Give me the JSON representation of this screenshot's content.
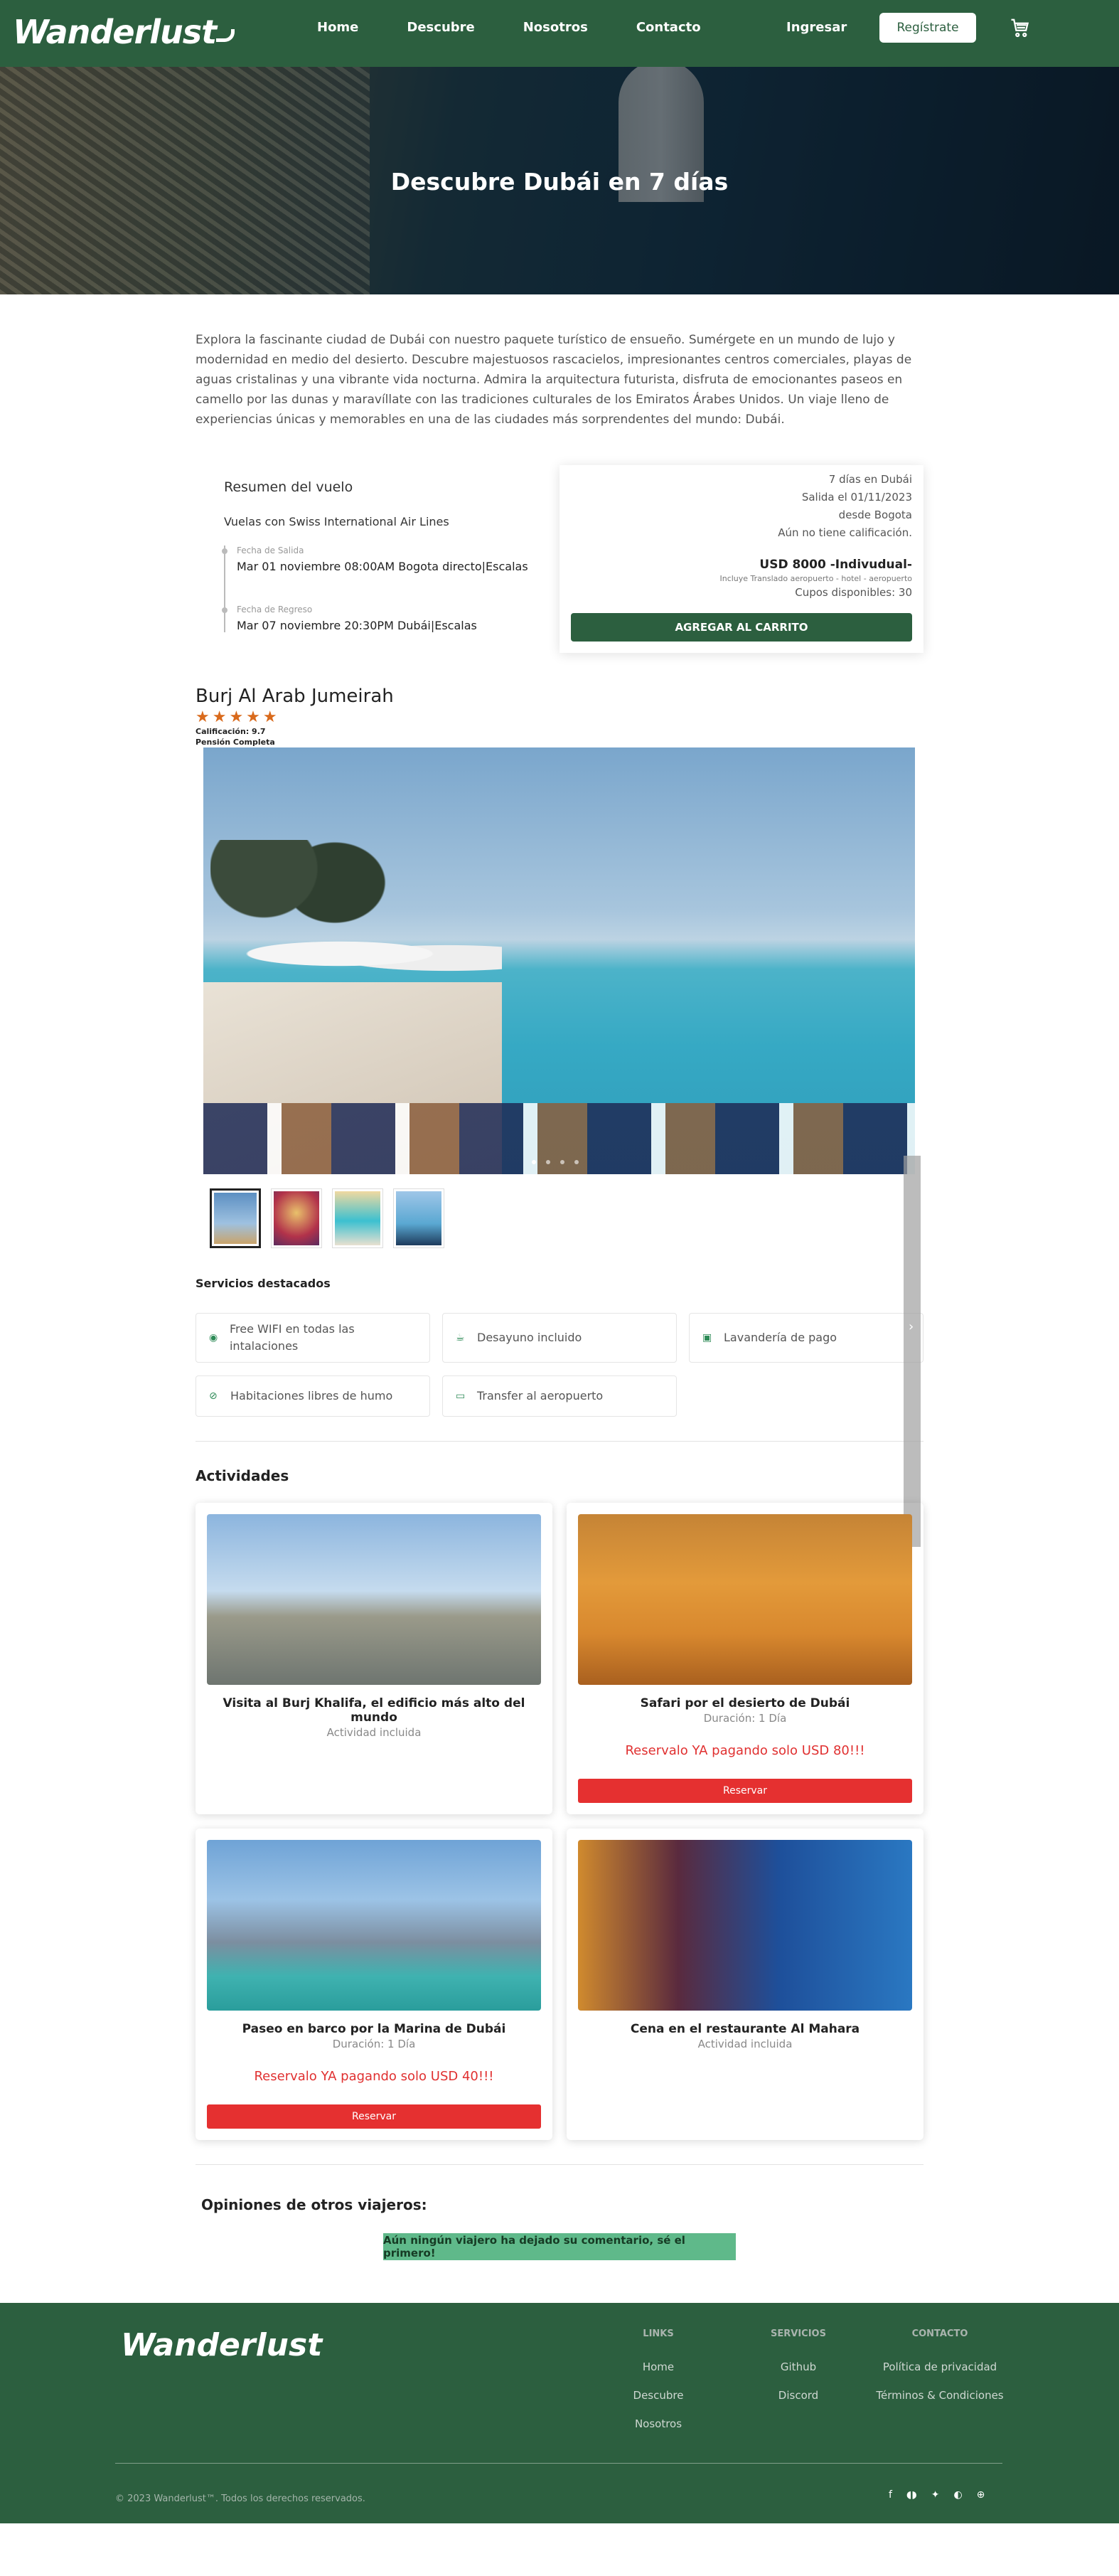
{
  "brand": "Wanderlust",
  "nav": {
    "links": [
      "Home",
      "Descubre",
      "Nosotros",
      "Contacto"
    ],
    "login": "Ingresar",
    "register": "Regístrate"
  },
  "hero": {
    "title": "Descubre Dubái en 7 días"
  },
  "intro": "Explora la fascinante ciudad de Dubái con nuestro paquete turístico de ensueño. Sumérgete en un mundo de lujo y modernidad en medio del desierto. Descubre majestuosos rascacielos, impresionantes centros comerciales, playas de aguas cristalinas y una vibrante vida nocturna. Admira la arquitectura futurista, disfruta de emocionantes paseos en camello por las dunas y maravíllate con las tradiciones culturales de los Emiratos Árabes Unidos. Un viaje lleno de experiencias únicas y memorables en una de las ciudades más sorprendentes del mundo: Dubái.",
  "flight": {
    "title": "Resumen del vuelo",
    "airline": "Vuelas con Swiss International Air Lines",
    "departure_label": "Fecha de Salida",
    "departure_value": "Mar 01 noviembre 08:00AM Bogota directo|Escalas",
    "return_label": "Fecha de Regreso",
    "return_value": "Mar 07 noviembre 20:30PM Dubái|Escalas",
    "duration": "7 días en Dubái",
    "departure_date": "Salida el 01/11/2023",
    "origin": "desde Bogota",
    "rating": "Aún no tiene calificación.",
    "price": "USD 8000 -Indivudual-",
    "includes": "Incluye Translado aeropuerto - hotel - aeropuerto",
    "seats": "Cupos disponibles: 30",
    "add_cart": "AGREGAR AL CARRITO"
  },
  "hotel": {
    "name": "Burj Al Arab Jumeirah",
    "stars": "★★★★★",
    "score": "Calificación: 9.7",
    "board": "Pensión Completa"
  },
  "services": {
    "title": "Servicios destacados",
    "items": [
      {
        "label": "Free WIFI en todas las intalaciones",
        "icon": "wifi-icon"
      },
      {
        "label": "Desayuno incluido",
        "icon": "coffee-icon"
      },
      {
        "label": "Lavandería de pago",
        "icon": "laundry-icon"
      },
      {
        "label": "Habitaciones libres de humo",
        "icon": "no-smoking-icon"
      },
      {
        "label": "Transfer al aeropuerto",
        "icon": "shuttle-icon"
      }
    ]
  },
  "activities": {
    "title": "Actividades",
    "items": [
      {
        "title": "Visita al Burj Khalifa, el edificio más alto del mundo",
        "sub": "Actividad incluida",
        "promo": "",
        "button": ""
      },
      {
        "title": "Safari por el desierto de Dubái",
        "sub": "Duración: 1 Día",
        "promo": "Reservalo YA pagando solo USD 80!!!",
        "button": "Reservar"
      },
      {
        "title": "Paseo en barco por la Marina de Dubái",
        "sub": "Duración: 1 Día",
        "promo": "Reservalo YA pagando solo USD 40!!!",
        "button": "Reservar"
      },
      {
        "title": "Cena en el restaurante Al Mahara",
        "sub": "Actividad incluida",
        "promo": "",
        "button": ""
      }
    ]
  },
  "reviews": {
    "title": "Opiniones de otros viajeros:",
    "empty": "Aún ningún viajero ha dejado su comentario, sé el primero!"
  },
  "footer": {
    "cols": [
      {
        "title": "LINKS",
        "links": [
          "Home",
          "Descubre",
          "Nosotros"
        ]
      },
      {
        "title": "SERVICIOS",
        "links": [
          "Github",
          "Discord"
        ]
      },
      {
        "title": "CONTACTO",
        "links": [
          "Política de privacidad",
          "Términos & Condiciones"
        ]
      }
    ],
    "copyright": "© 2023 Wanderlust™. Todos los derechos reservados."
  }
}
